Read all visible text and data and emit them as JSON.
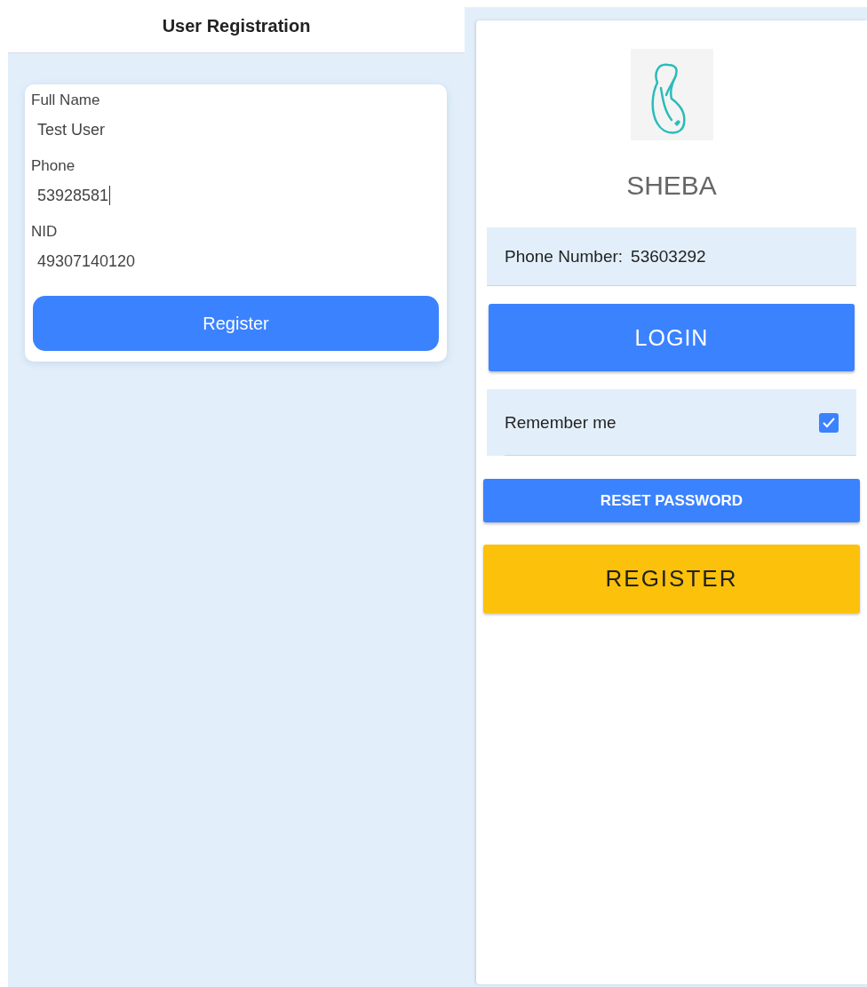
{
  "registration": {
    "title": "User Registration",
    "fields": [
      {
        "label": "Full Name",
        "value": "Test User",
        "focused": false
      },
      {
        "label": "Phone",
        "value": "53928581",
        "focused": true
      },
      {
        "label": "NID",
        "value": "49307140120",
        "focused": false
      }
    ],
    "submit_button": "Register"
  },
  "login": {
    "app_name": "SHEBA",
    "phone_field": {
      "label": "Phone Number:",
      "value": "53603292"
    },
    "login_button": "LOGIN",
    "remember": {
      "label": "Remember me",
      "checked": true
    },
    "reset_button": "RESET PASSWORD",
    "register_button": "REGISTER"
  }
}
